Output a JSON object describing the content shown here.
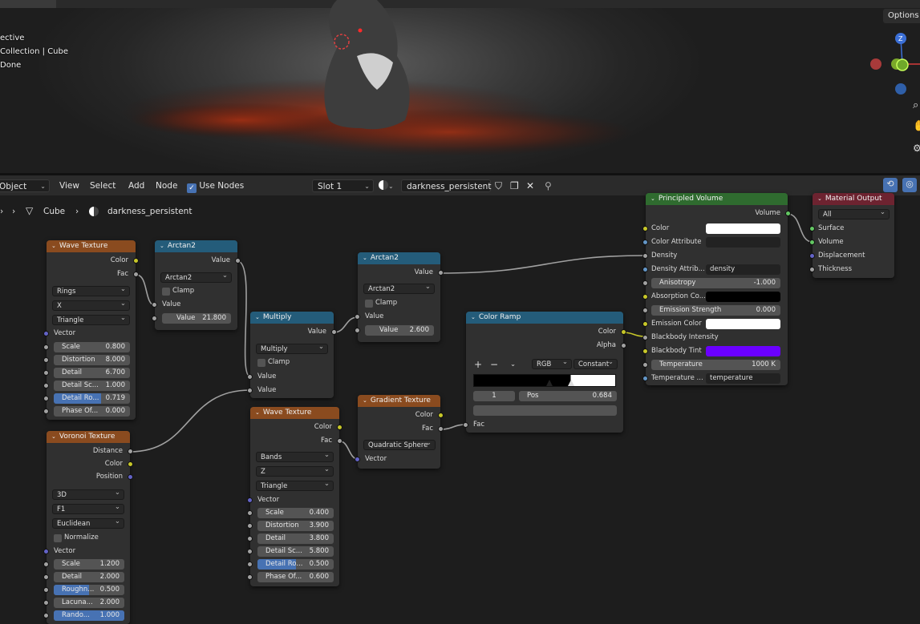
{
  "viewport": {
    "info_lines": [
      "ective",
      "Collection | Cube",
      "Done"
    ],
    "options_label": "Options"
  },
  "header": {
    "mode": "Object",
    "menus": [
      "View",
      "Select",
      "Add",
      "Node"
    ],
    "use_nodes_label": "Use Nodes",
    "slot": "Slot 1",
    "material": "darkness_persistent"
  },
  "breadcrumb": {
    "object": "Cube",
    "material": "darkness_persistent"
  },
  "nodes": {
    "wave1": {
      "title": "Wave Texture",
      "outputs": [
        "Color",
        "Fac"
      ],
      "dropdowns": [
        "Rings",
        "X",
        "Triangle"
      ],
      "vector": "Vector",
      "fields": [
        {
          "label": "Scale",
          "value": "0.800"
        },
        {
          "label": "Distortion",
          "value": "8.000"
        },
        {
          "label": "Detail",
          "value": "6.700"
        },
        {
          "label": "Detail Sc...",
          "value": "1.000"
        },
        {
          "label": "Detail Ro...",
          "value": "0.719"
        },
        {
          "label": "Phase Of...",
          "value": "0.000"
        }
      ]
    },
    "arctan_a": {
      "title": "Arctan2",
      "output": "Value",
      "dropdown": "Arctan2",
      "clamp": "Clamp",
      "input": "Value",
      "field": {
        "label": "Value",
        "value": "21.800"
      }
    },
    "multiply": {
      "title": "Multiply",
      "output": "Value",
      "dropdown": "Multiply",
      "clamp": "Clamp",
      "inputs": [
        "Value",
        "Value"
      ]
    },
    "arctan_b": {
      "title": "Arctan2",
      "output": "Value",
      "dropdown": "Arctan2",
      "clamp": "Clamp",
      "input": "Value",
      "field": {
        "label": "Value",
        "value": "2.600"
      }
    },
    "voronoi": {
      "title": "Voronoi Texture",
      "outputs": [
        "Distance",
        "Color",
        "Position"
      ],
      "dropdowns": [
        "3D",
        "F1",
        "Euclidean"
      ],
      "normalize": "Normalize",
      "vector": "Vector",
      "fields": [
        {
          "label": "Scale",
          "value": "1.200"
        },
        {
          "label": "Detail",
          "value": "2.000"
        },
        {
          "label": "Roughn...",
          "value": "0.500"
        },
        {
          "label": "Lacuna...",
          "value": "2.000"
        },
        {
          "label": "Rando...",
          "value": "1.000"
        }
      ]
    },
    "wave2": {
      "title": "Wave Texture",
      "outputs": [
        "Color",
        "Fac"
      ],
      "dropdowns": [
        "Bands",
        "Z",
        "Triangle"
      ],
      "vector": "Vector",
      "fields": [
        {
          "label": "Scale",
          "value": "0.400"
        },
        {
          "label": "Distortion",
          "value": "3.900"
        },
        {
          "label": "Detail",
          "value": "3.800"
        },
        {
          "label": "Detail Sc...",
          "value": "5.800"
        },
        {
          "label": "Detail Ro...",
          "value": "0.500"
        },
        {
          "label": "Phase Of...",
          "value": "0.600"
        }
      ]
    },
    "gradient": {
      "title": "Gradient Texture",
      "outputs": [
        "Color",
        "Fac"
      ],
      "dropdown": "Quadratic Sphere",
      "vector": "Vector"
    },
    "colorramp": {
      "title": "Color Ramp",
      "outputs": [
        "Color",
        "Alpha"
      ],
      "mode": "RGB",
      "interp": "Constant",
      "index": "1",
      "pos_label": "Pos",
      "pos_value": "0.684",
      "input": "Fac"
    },
    "volume": {
      "title": "Principled Volume",
      "output": "Volume",
      "rows": {
        "color": "Color",
        "color_attr": "Color Attribute",
        "density": "Density",
        "density_attr": "Density Attrib...",
        "density_attr_value": "density",
        "anisotropy": "Anisotropy",
        "anisotropy_value": "-1.000",
        "absorption": "Absorption Co...",
        "emission_strength": "Emission Strength",
        "emission_strength_value": "0.000",
        "emission_color": "Emission Color",
        "blackbody_intensity": "Blackbody Intensity",
        "blackbody_tint": "Blackbody Tint",
        "temperature": "Temperature",
        "temperature_value": "1000 K",
        "temperature_attr": "Temperature ...",
        "temperature_attr_value": "temperature"
      },
      "colors": {
        "color": "#ffffff",
        "absorption": "#000000",
        "emission": "#ffffff",
        "tint": "#6a00ff"
      }
    },
    "output": {
      "title": "Material Output",
      "target": "All",
      "inputs": [
        "Surface",
        "Volume",
        "Displacement",
        "Thickness"
      ]
    }
  }
}
